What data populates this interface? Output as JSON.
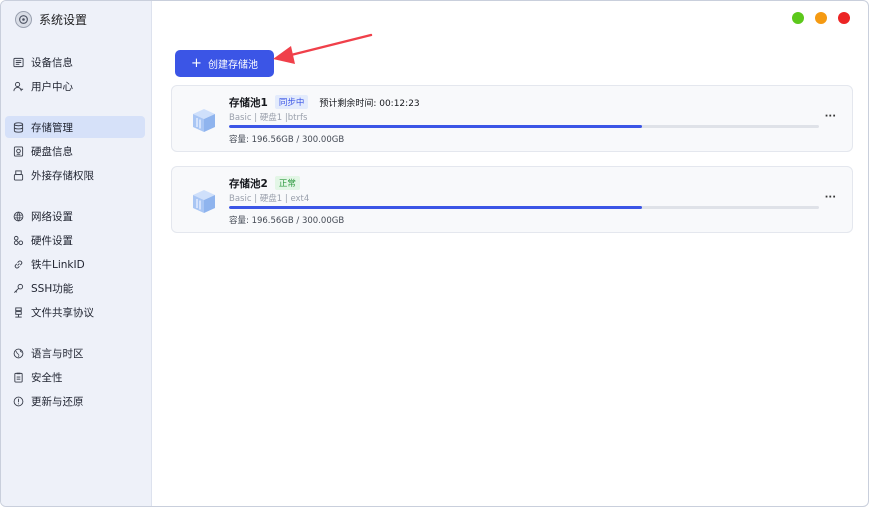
{
  "app": {
    "title": "系统设置"
  },
  "window_controls": [
    {
      "name": "green",
      "color": "#5cc81b"
    },
    {
      "name": "orange",
      "color": "#f59a12"
    },
    {
      "name": "red",
      "color": "#ec2424"
    }
  ],
  "sidebar": {
    "items": [
      {
        "label": "设备信息",
        "icon": "device-info-icon"
      },
      {
        "label": "用户中心",
        "icon": "user-icon"
      },
      {
        "label": "存储管理",
        "icon": "storage-icon",
        "active": true
      },
      {
        "label": "硬盘信息",
        "icon": "disk-icon"
      },
      {
        "label": "外接存储权限",
        "icon": "external-storage-icon"
      },
      {
        "label": "网络设置",
        "icon": "network-icon"
      },
      {
        "label": "硬件设置",
        "icon": "hardware-icon"
      },
      {
        "label": "铁牛LinkID",
        "icon": "link-icon"
      },
      {
        "label": "SSH功能",
        "icon": "key-icon"
      },
      {
        "label": "文件共享协议",
        "icon": "file-share-icon"
      },
      {
        "label": "语言与时区",
        "icon": "globe-icon"
      },
      {
        "label": "安全性",
        "icon": "security-icon"
      },
      {
        "label": "更新与还原",
        "icon": "update-icon"
      }
    ]
  },
  "main": {
    "create_button": {
      "label": "创建存储池",
      "icon": "plus-icon"
    },
    "pools": [
      {
        "name": "存储池1",
        "status": "同步中",
        "status_type": "sync",
        "remaining_label": "预计剩余时间: 00:12:23",
        "meta": "Basic | 硬盘1 |btrfs",
        "progress": 0.7,
        "capacity": "容量: 196.56GB / 300.00GB",
        "more": "···"
      },
      {
        "name": "存储池2",
        "status": "正常",
        "status_type": "ok",
        "remaining_label": "",
        "meta": "Basic | 硬盘1 | ext4",
        "progress": 0.7,
        "capacity": "容量: 196.56GB / 300.00GB",
        "more": "···"
      }
    ]
  },
  "colors": {
    "accent": "#3b55e6",
    "annotation_arrow": "#f0404a"
  }
}
